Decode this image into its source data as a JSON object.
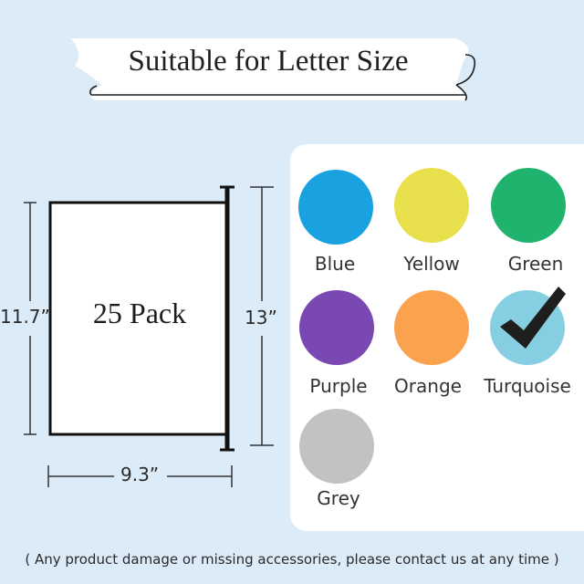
{
  "banner": {
    "title": "Suitable for Letter Size"
  },
  "diagram": {
    "pack_label": "25 Pack",
    "height_label": "11.7”",
    "hanger_height_label": "13”",
    "width_label": "9.3”"
  },
  "colors": {
    "blue": {
      "name": "Blue",
      "hex": "#1aa1e0"
    },
    "yellow": {
      "name": "Yellow",
      "hex": "#e8e04c"
    },
    "green": {
      "name": "Green",
      "hex": "#1fb36e"
    },
    "purple": {
      "name": "Purple",
      "hex": "#7a48b2"
    },
    "orange": {
      "name": "Orange",
      "hex": "#fba24e"
    },
    "turquoise": {
      "name": "Turquoise",
      "hex": "#86cfe2",
      "selected": true,
      "marker_icon": "checkmark-icon"
    },
    "grey": {
      "name": "Grey",
      "hex": "#c2c2c2"
    }
  },
  "footer": {
    "note": "( Any product damage or missing accessories, please contact us at any time )"
  }
}
